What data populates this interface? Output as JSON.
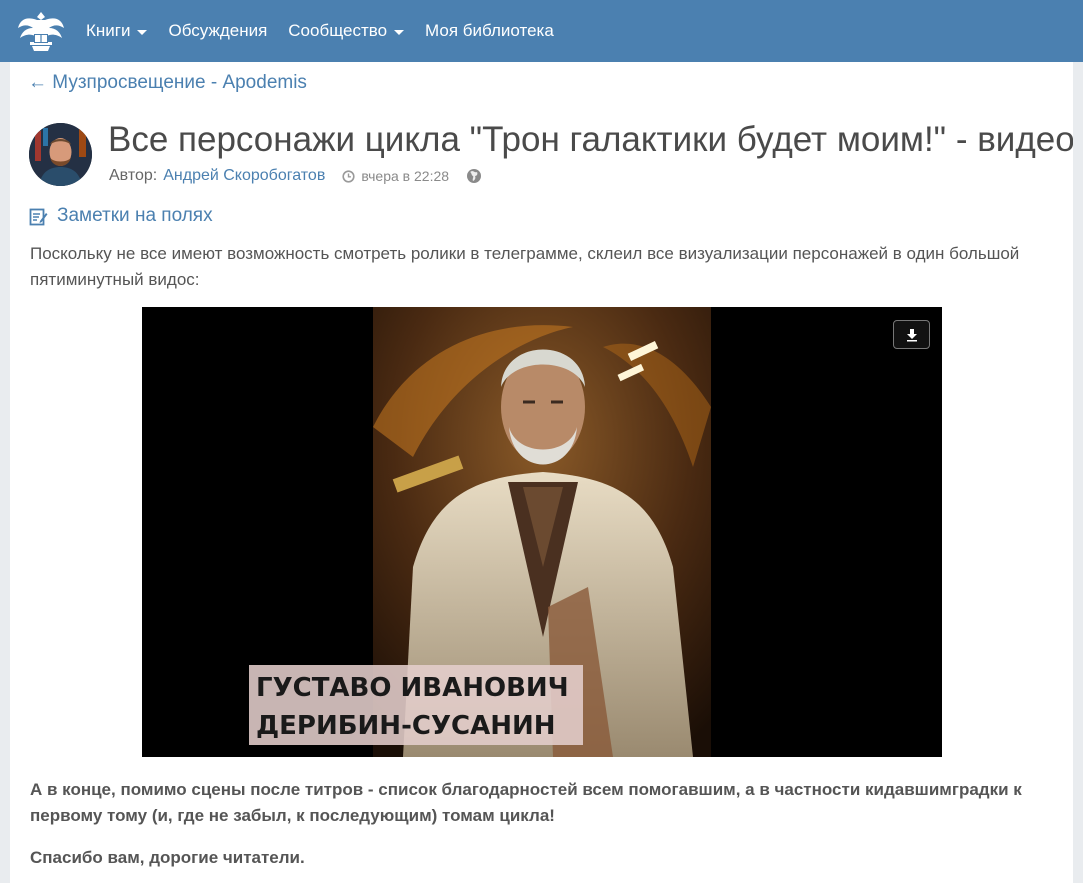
{
  "navbar": {
    "items": [
      {
        "label": "Книги",
        "dropdown": true
      },
      {
        "label": "Обсуждения",
        "dropdown": false
      },
      {
        "label": "Сообщество",
        "dropdown": true
      },
      {
        "label": "Моя библиотека",
        "dropdown": false
      }
    ]
  },
  "breadcrumb": {
    "back_label": "← Музпросвещение - Apodemis"
  },
  "post": {
    "title": "Все персонажи цикла \"Трон галактики будет моим!\" - видео",
    "author_prefix": "Автор:",
    "author_name": "Андрей Скоробогатов",
    "time": "вчера в 22:28",
    "notes_label": "Заметки на полях",
    "paragraph1": "Поскольку не все имеют возможность смотреть ролики в телеграмме, склеил все визуализации персонажей в один большой пятиминутный видос:",
    "video_caption_line1": "ГУСТАВО ИВАНОВИЧ",
    "video_caption_line2": "ДЕРИБИН-СУСАНИН",
    "paragraph2": "А в конце, помимо сцены после титров - список благодарностей всем помогавшим, а в частности кидавшимградки к первому тому (и, где не забыл, к последующим) томам цикла!",
    "paragraph3": "Спасибо вам, дорогие читатели."
  },
  "colors": {
    "navbar": "#4b80b0",
    "link": "#4b80b0",
    "text": "#555555"
  },
  "icons": [
    "eagle-logo-icon",
    "clock-icon",
    "globe-icon",
    "notes-edit-icon",
    "download-icon"
  ]
}
